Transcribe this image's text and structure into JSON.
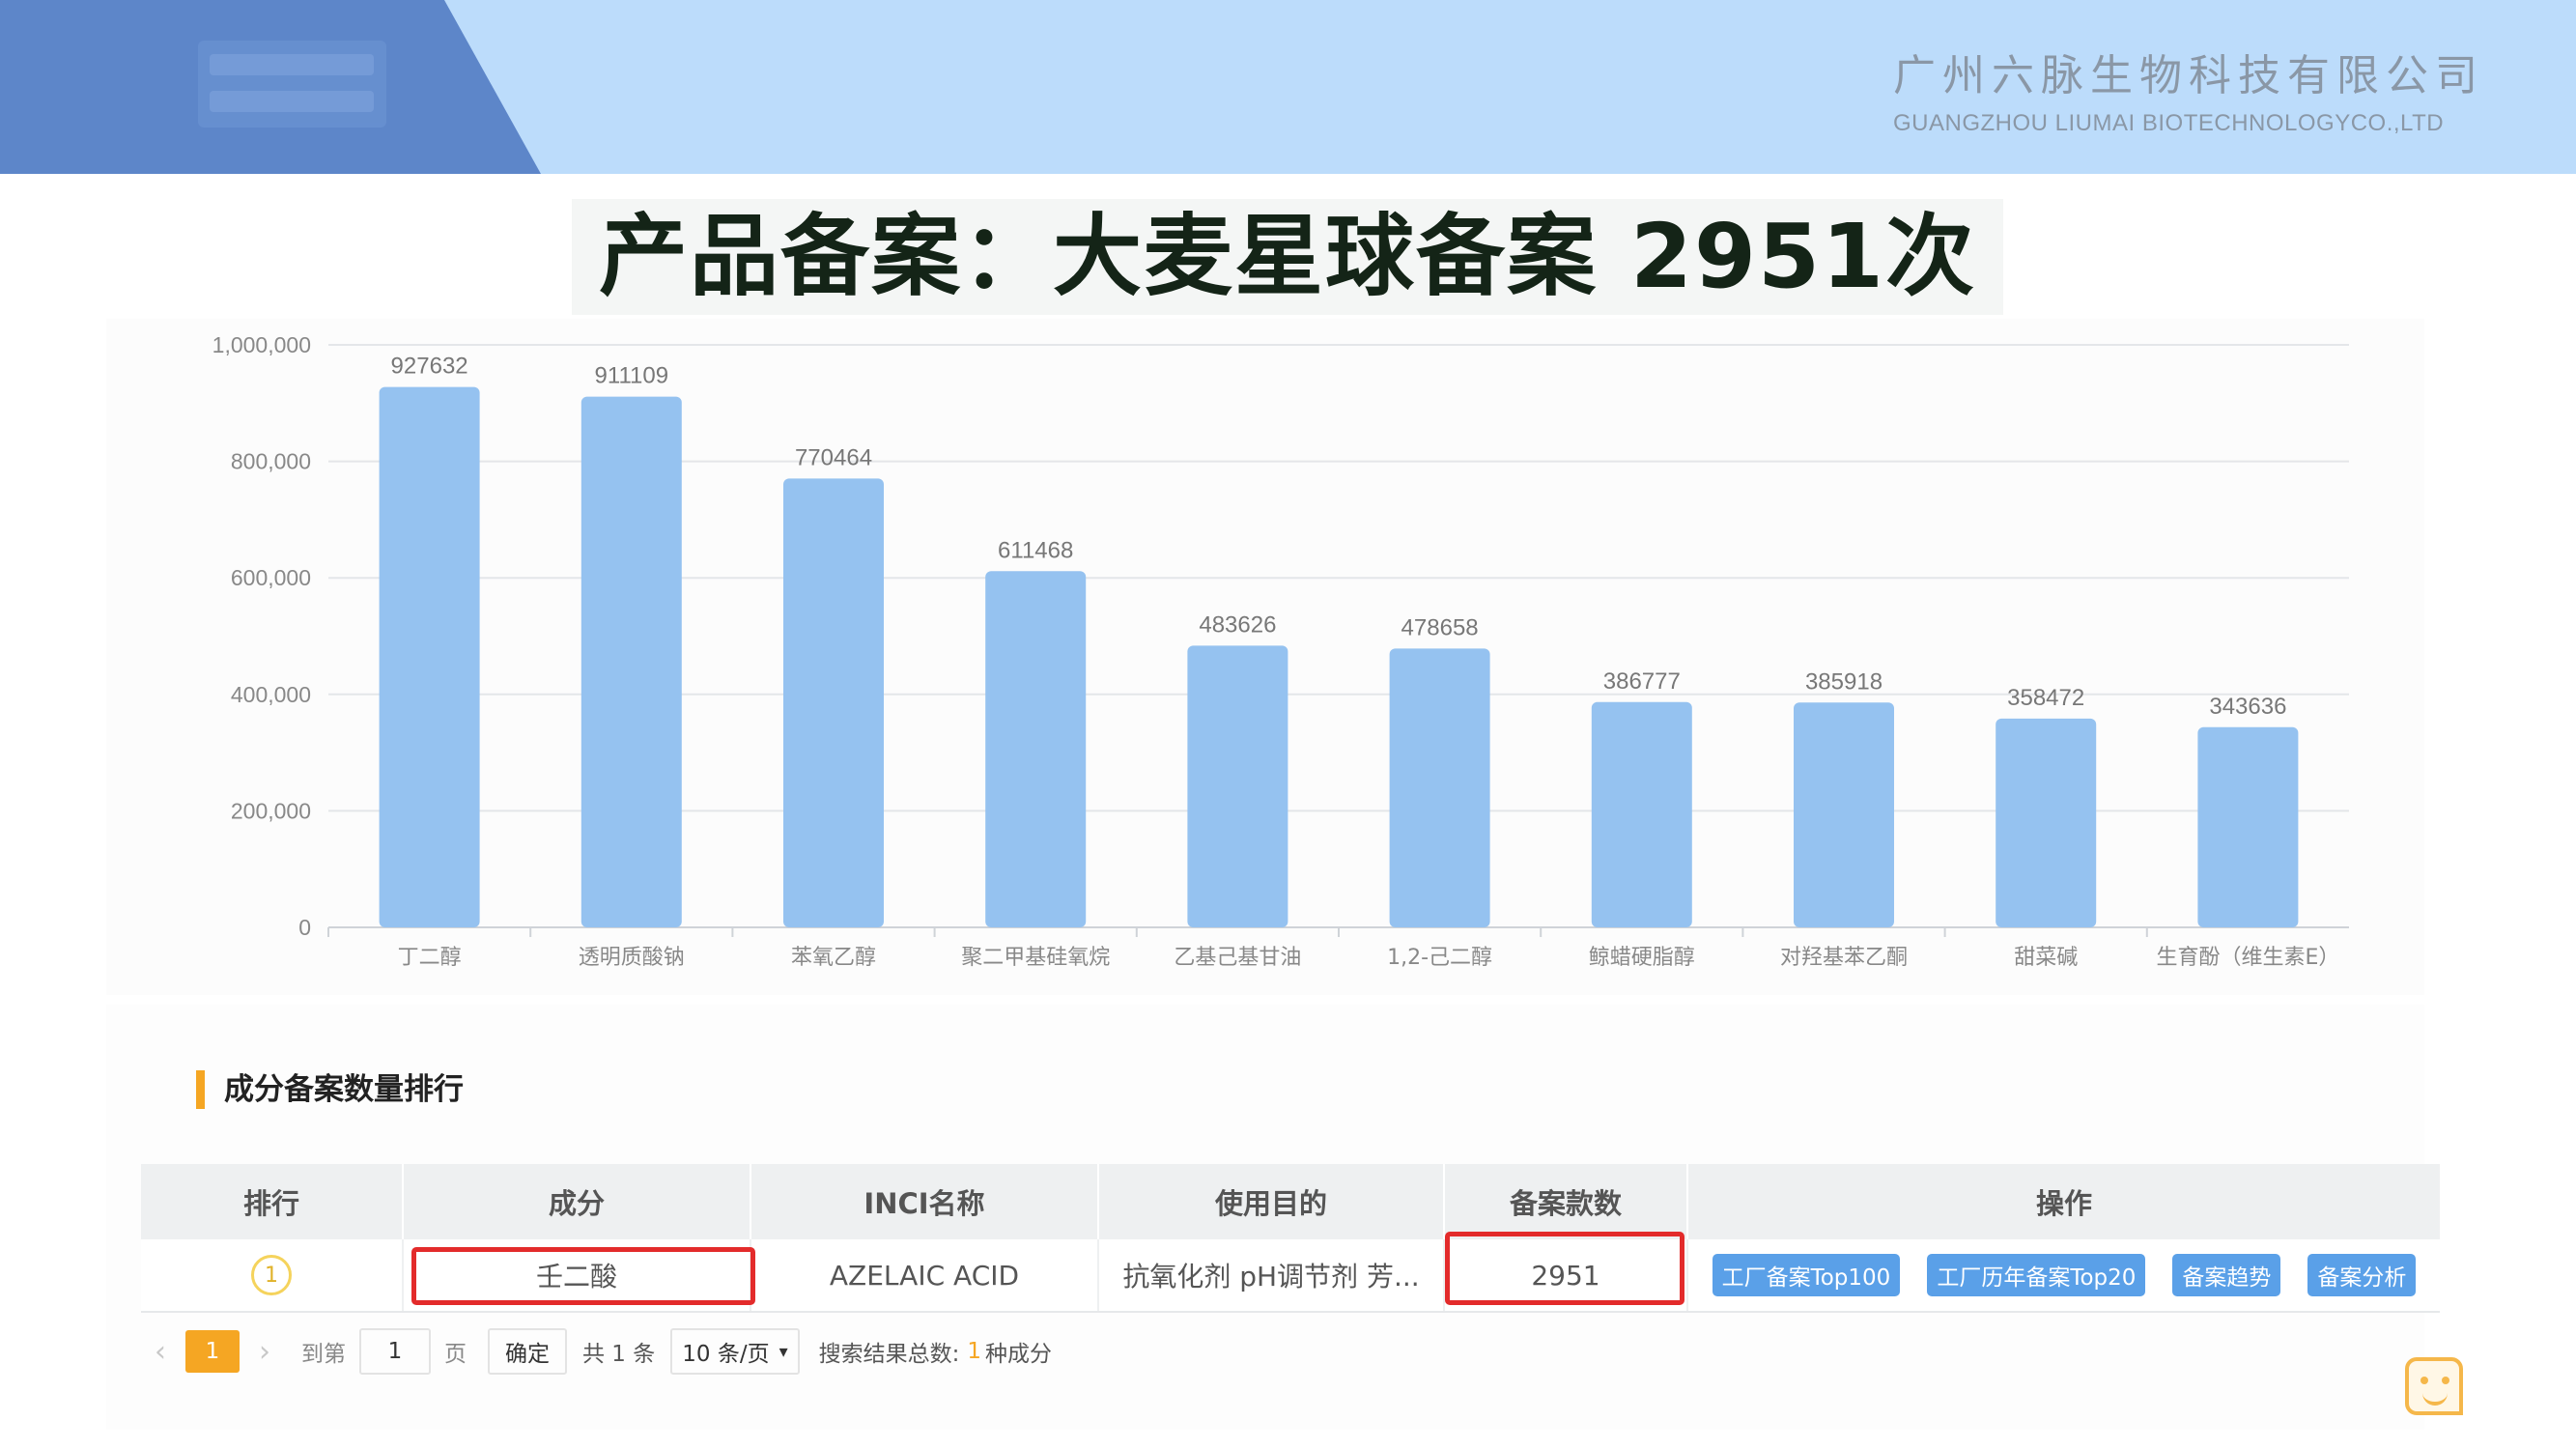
{
  "header": {
    "company_cn": "广州六脉生物科技有限公司",
    "company_en": "GUANGZHOU LIUMAI BIOTECHNOLOGYCO.,LTD",
    "brand_color": "#5d86c9",
    "banner_color": "#bcdcfb"
  },
  "title": "产品备案：大麦星球备案 2951次",
  "chart_data": {
    "type": "bar",
    "categories": [
      "丁二醇",
      "透明质酸钠",
      "苯氧乙醇",
      "聚二甲基硅氧烷",
      "乙基己基甘油",
      "1,2-己二醇",
      "鲸蜡硬脂醇",
      "对羟基苯乙酮",
      "甜菜碱",
      "生育酚（维生素E）"
    ],
    "values": [
      927632,
      911109,
      770464,
      611468,
      483626,
      478658,
      386777,
      385918,
      358472,
      343636
    ],
    "title": "",
    "xlabel": "",
    "ylabel": "",
    "ylim": [
      0,
      1000000
    ],
    "yticks": [
      "0",
      "200,000",
      "400,000",
      "600,000",
      "800,000",
      "1,000,000"
    ],
    "grid": true,
    "bar_color": "#95c2f0"
  },
  "ranking": {
    "section_title": "成分备案数量排行",
    "columns": [
      "排行",
      "成分",
      "INCI名称",
      "使用目的",
      "备案款数",
      "操作"
    ],
    "rows": [
      {
        "rank": "1",
        "ingredient": "壬二酸",
        "inci": "AZELAIC ACID",
        "purpose": "抗氧化剂 pH调节剂 芳...",
        "count": "2951",
        "actions": [
          "工厂备案Top100",
          "工厂历年备案Top20",
          "备案趋势",
          "备案分析"
        ]
      }
    ],
    "pager": {
      "prev_icon": "chevron-left-icon",
      "current_page": "1",
      "next_icon": "chevron-right-icon",
      "goto_label": "到第",
      "goto_value": "1",
      "page_label": "页",
      "confirm_label": "确定",
      "total_label": "共 1 条",
      "page_size": "10 条/页",
      "results_label": "搜索结果总数:",
      "results_count": "1",
      "results_unit": "种成分"
    }
  }
}
